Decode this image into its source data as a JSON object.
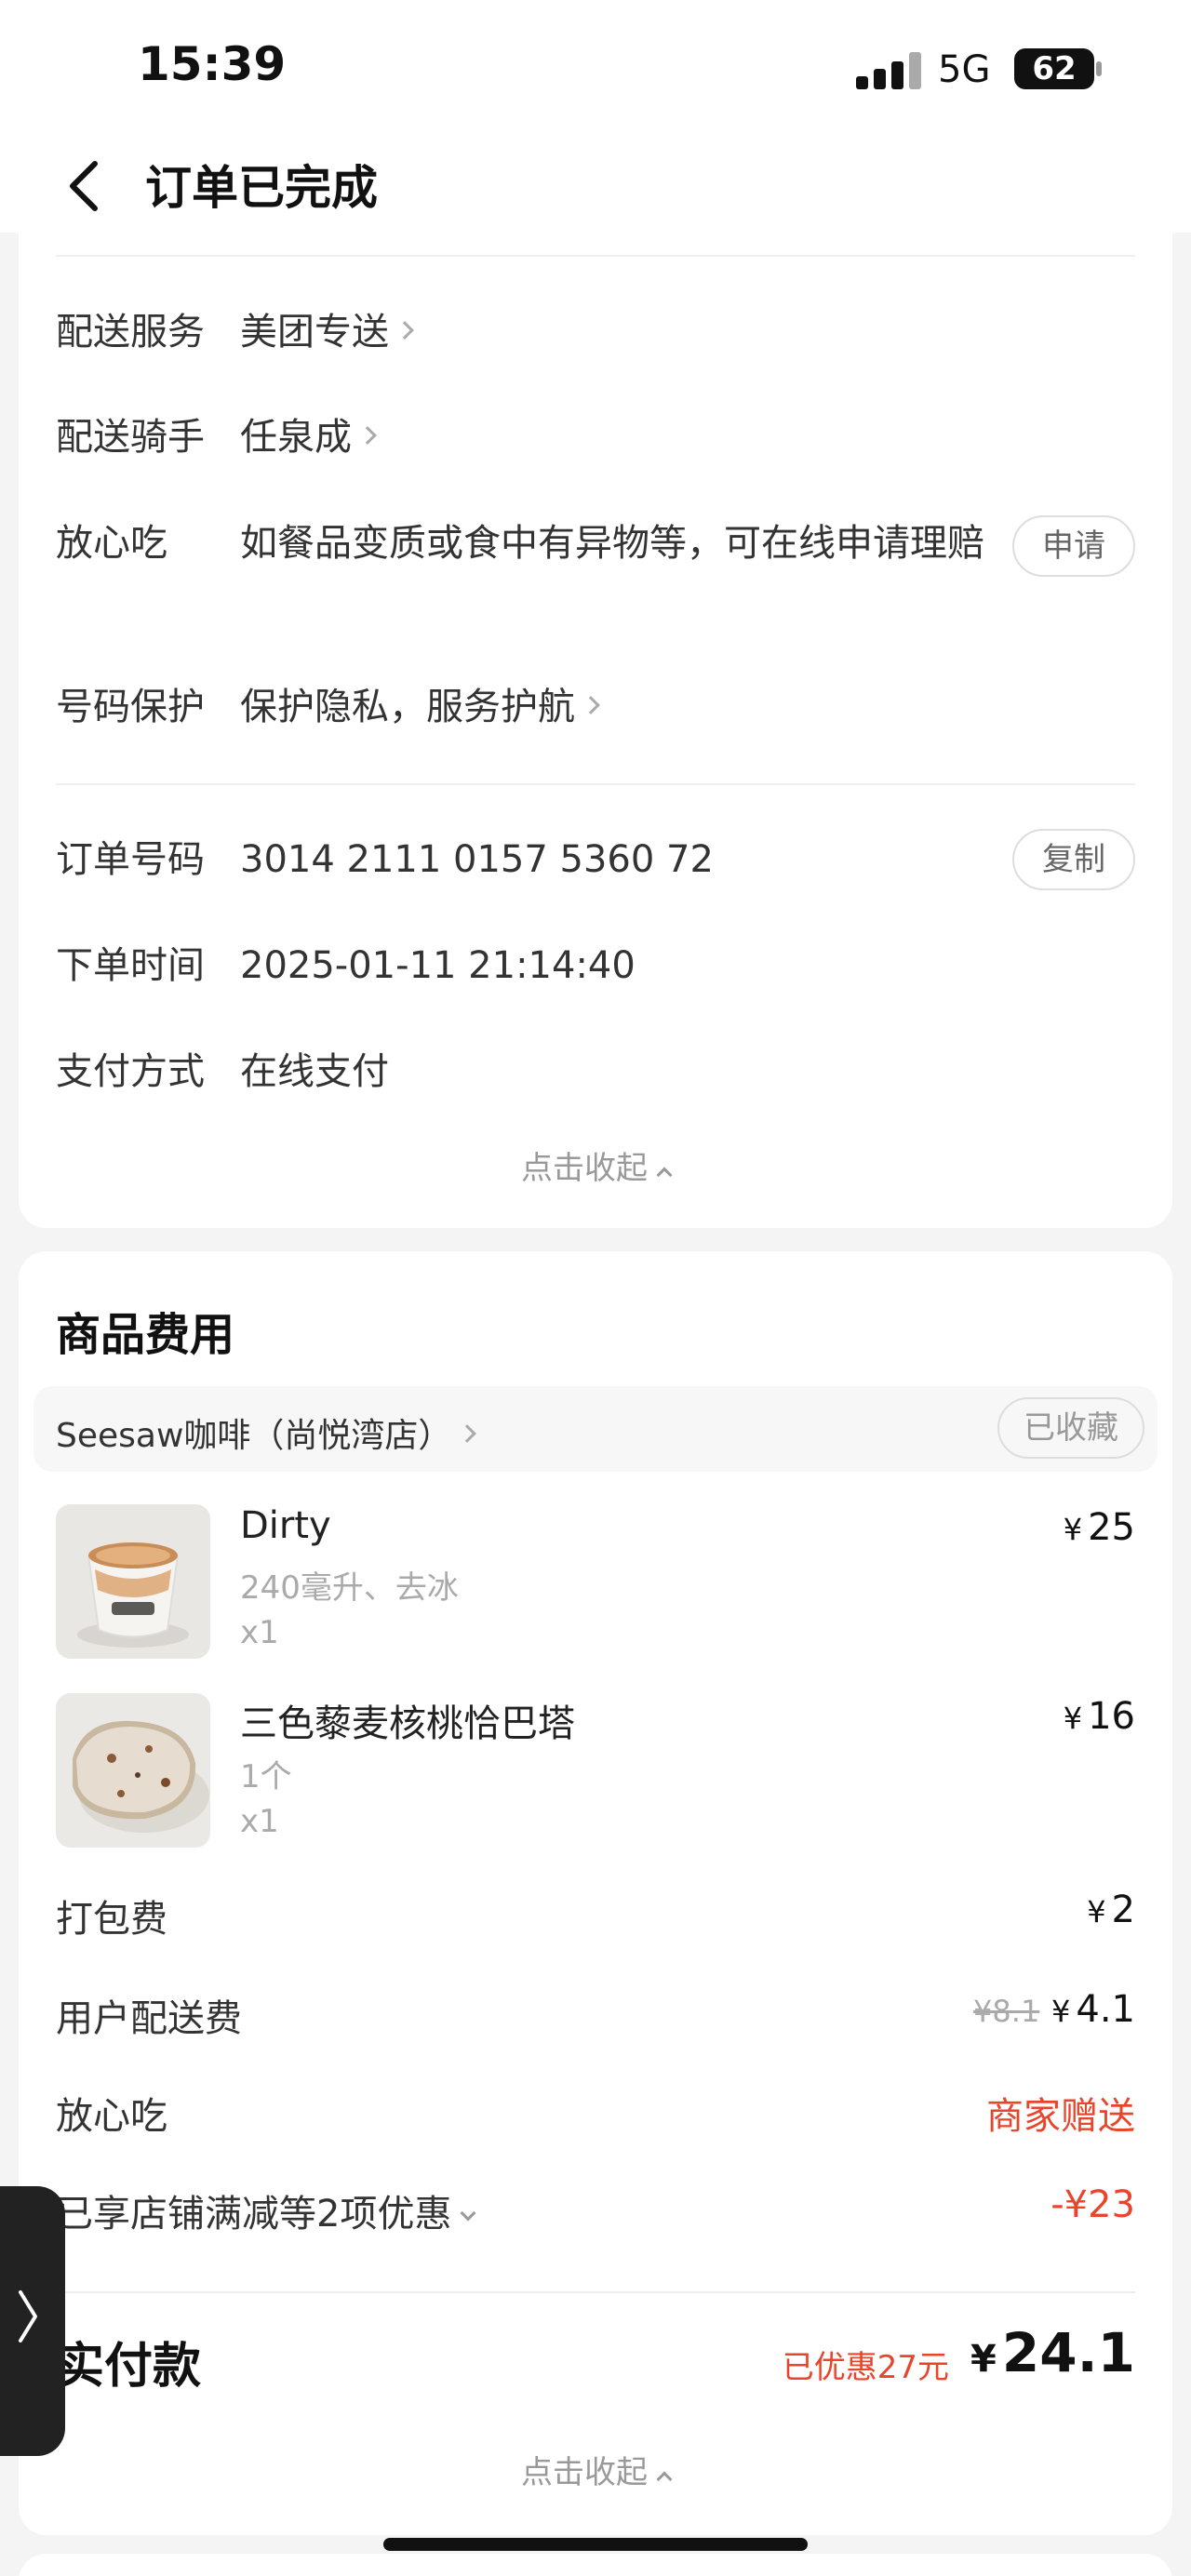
{
  "status": {
    "time": "15:39",
    "network": "5G",
    "battery": "62"
  },
  "nav": {
    "title": "订单已完成"
  },
  "delivery": {
    "service_label": "配送服务",
    "service_value": "美团专送",
    "rider_label": "配送骑手",
    "rider_value": "任泉成",
    "safe_label": "放心吃",
    "safe_value": "如餐品变质或食中有异物等，可在线申请理赔",
    "safe_button": "申请",
    "privacy_label": "号码保护",
    "privacy_value": "保护隐私，服务护航"
  },
  "order": {
    "number_label": "订单号码",
    "number_value": "3014 2111 0157 5360 72",
    "copy_button": "复制",
    "time_label": "下单时间",
    "time_value": "2025-01-11 21:14:40",
    "pay_label": "支付方式",
    "pay_value": "在线支付",
    "collapse": "点击收起"
  },
  "goods": {
    "title": "商品费用",
    "shop_name": "Seesaw咖啡（尚悦湾店）",
    "fav_button": "已收藏",
    "items": [
      {
        "name": "Dirty",
        "spec": "240毫升、去冰",
        "qty": "x1",
        "currency": "¥",
        "price": "25"
      },
      {
        "name": "三色藜麦核桃恰巴塔",
        "spec": "1个",
        "qty": "x1",
        "currency": "¥",
        "price": "16"
      }
    ],
    "packing_label": "打包费",
    "packing_currency": "¥",
    "packing_value": "2",
    "delivery_fee_label": "用户配送费",
    "delivery_fee_original": "¥8.1",
    "delivery_fee_currency": "¥",
    "delivery_fee_value": "4.1",
    "safe_label": "放心吃",
    "safe_value": "商家赠送",
    "discount_label": "已享店铺满减等2项优惠",
    "discount_value": "-¥23",
    "total_label": "实付款",
    "total_discount": "已优惠27元",
    "total_currency": "¥",
    "total_value": "24.1",
    "collapse": "点击收起"
  },
  "colors": {
    "accent_red": "#e8452c",
    "background": "#f4f4f4"
  },
  "icons": [
    "back-arrow-icon",
    "chevron-right-icon",
    "chevron-up-icon",
    "chevron-down-icon",
    "side-handle-arrow-icon"
  ]
}
